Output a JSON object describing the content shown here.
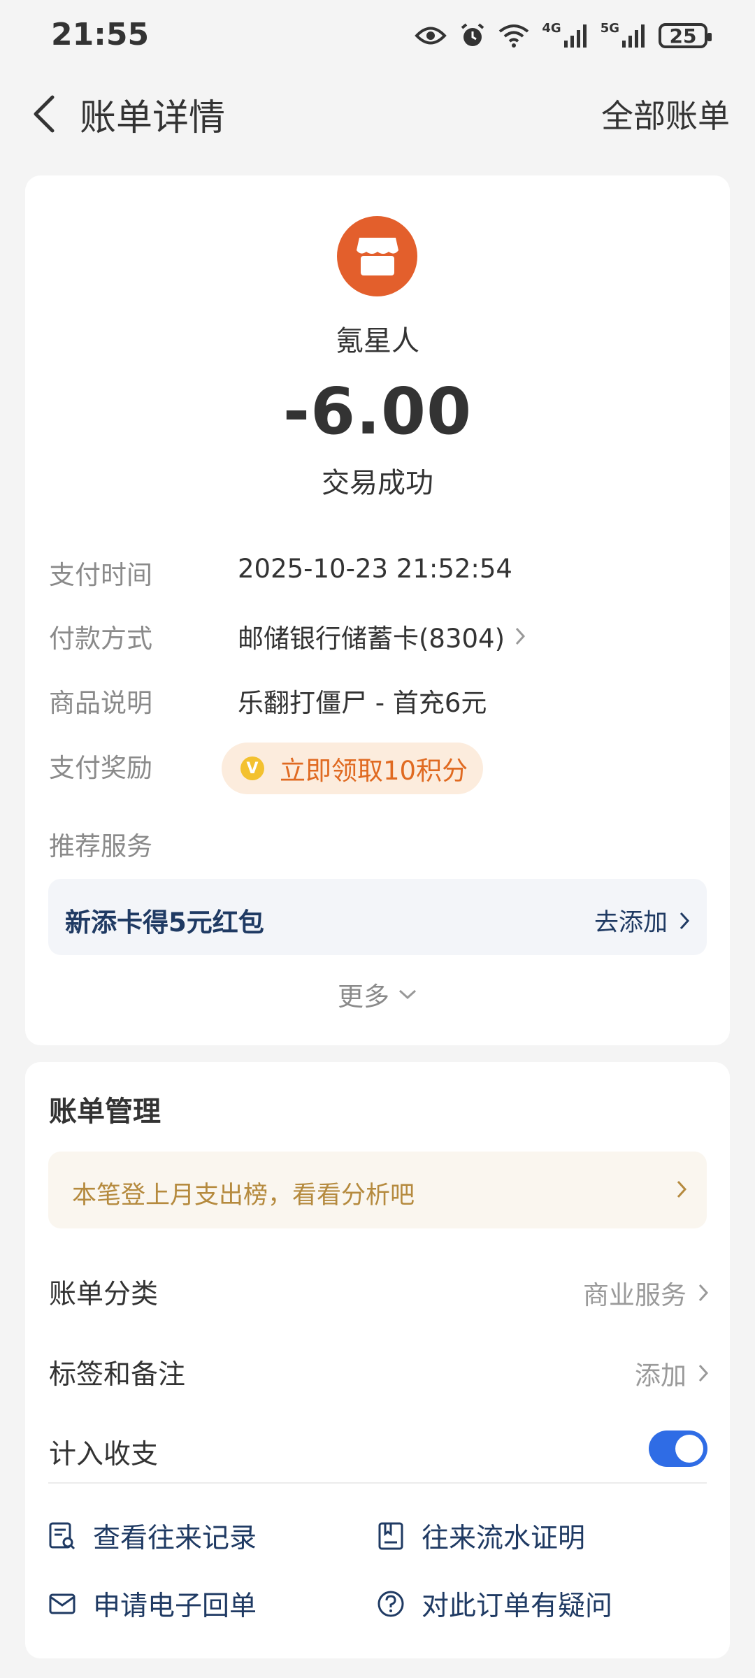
{
  "status_bar": {
    "time": "21:55",
    "battery": "25",
    "net1": "4G",
    "net2": "5G"
  },
  "header": {
    "title": "账单详情",
    "right_action": "全部账单"
  },
  "merchant": {
    "name": "氪星人",
    "amount": "-6.00",
    "status": "交易成功",
    "logo_color": "#e35f2c"
  },
  "details": [
    {
      "label": "支付时间",
      "value": "2025-10-23 21:52:54"
    },
    {
      "label": "付款方式",
      "value": "邮储银行储蓄卡(8304)"
    },
    {
      "label": "商品说明",
      "value": "乐翻打僵尸 - 首充6元"
    }
  ],
  "reward": {
    "label": "支付奖励",
    "text": "立即领取10积分",
    "coin_glyph": "V"
  },
  "recommend": {
    "label": "推荐服务",
    "promo_title": "新添卡得5元红包",
    "promo_action": "去添加",
    "more": "更多"
  },
  "management": {
    "title": "账单管理",
    "notice": "本笔登上月支出榜，看看分析吧",
    "category_label": "账单分类",
    "category_value": "商业服务",
    "tags_label": "标签和备注",
    "tags_value": "添加",
    "include_label": "计入收支",
    "include_on": true
  },
  "actions": [
    {
      "label": "查看往来记录",
      "icon": "records-icon"
    },
    {
      "label": "往来流水证明",
      "icon": "certificate-icon"
    },
    {
      "label": "申请电子回单",
      "icon": "mail-icon"
    },
    {
      "label": "对此订单有疑问",
      "icon": "question-icon"
    }
  ],
  "colors": {
    "accent": "#2f6ce5",
    "navy": "#1f3a63",
    "orange": "#e06a21"
  }
}
